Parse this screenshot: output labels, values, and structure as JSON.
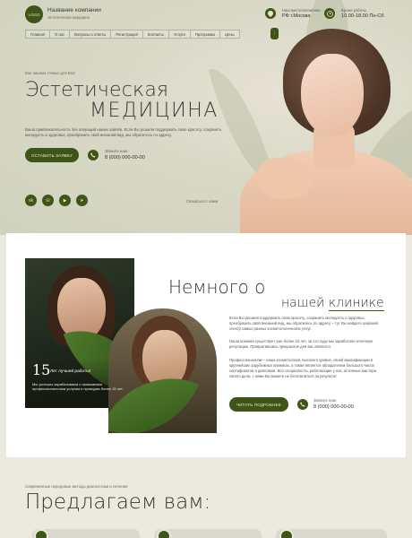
{
  "company": {
    "logo": "LOGO",
    "name": "Название компании",
    "tagline": "Эстетическая медицина"
  },
  "contacts": {
    "address_label": "Наш местоположение",
    "address": "РФ г.Москва",
    "hours_label": "Время работы",
    "hours": "10.00-18.00 Пн-Сб"
  },
  "nav": [
    "Главная",
    "О нас",
    "Вопросы и ответы",
    "Регистрация",
    "Контакты",
    "Услуги",
    "Программа",
    "Цены"
  ],
  "hero": {
    "pretitle": "Вне лишних точных для Вас!",
    "title_line1": "Эстетическая",
    "title_line2": "МЕДИЦИНА",
    "description": "Ваша привлекательность без операций наших хайлёв. Если Вы решили поддержать свою красоту, сохранить молодость и здоровье, преобразить свой внешний вид, мы обратитесь по адресу.",
    "cta": "ОСТАВИТЬ ЗАЯВКУ",
    "phone_label": "Звоните нам:",
    "phone": "8 (000) 000-00-00",
    "social_label": "Связаться с нами"
  },
  "about": {
    "years_number": "15",
    "years_label": "Лет лучшей работы!",
    "years_text": "Мы успешно зарабатываем и занимаемся профессиональным услугам и проводим более 15 лет.",
    "title_line1": "Немного о",
    "title_line2_pre": "нашей ",
    "title_line2_accent": "клинике",
    "p1": "Если Вы решили поддержать свою красоту, сохранить молодость и здоровье, преобразить свой внешний вид, мы обратитесь по адресу – тут Вы найдете широкий спектр самых разных косметологических услуг.",
    "p2": "Наша клиника существует уже более 15 лет, за это годы мы заработали отличную репутацию. Превратившись прекрасное для вас является.",
    "p3": "Профессионализм – наша косметология, высокого уровня, своей квалификации в крупнейших зарубежных клиниках, а также является обладателем большого числа сертификатов и дипломов. Все специалисты, работающие у нас, истинные мастера своего дела, с ними Вы можете не беспокоиться за результат.",
    "cta": "ЧИТАТЬ ПОДРОБНЕЕ",
    "phone_label": "Звоните нам:",
    "phone": "8 (000) 000-00-00"
  },
  "offer": {
    "pretitle": "Современные передовые методы диагностики и лечения",
    "title": "Предлагаем вам:"
  },
  "colors": {
    "accent": "#3f5518",
    "hero_bg": "#d9d8c6",
    "page_bg": "#ece9df"
  },
  "icons": [
    "map-pin-icon",
    "clock-icon",
    "phone-icon",
    "vk-icon",
    "whatsapp-icon",
    "youtube-icon",
    "telegram-icon"
  ]
}
